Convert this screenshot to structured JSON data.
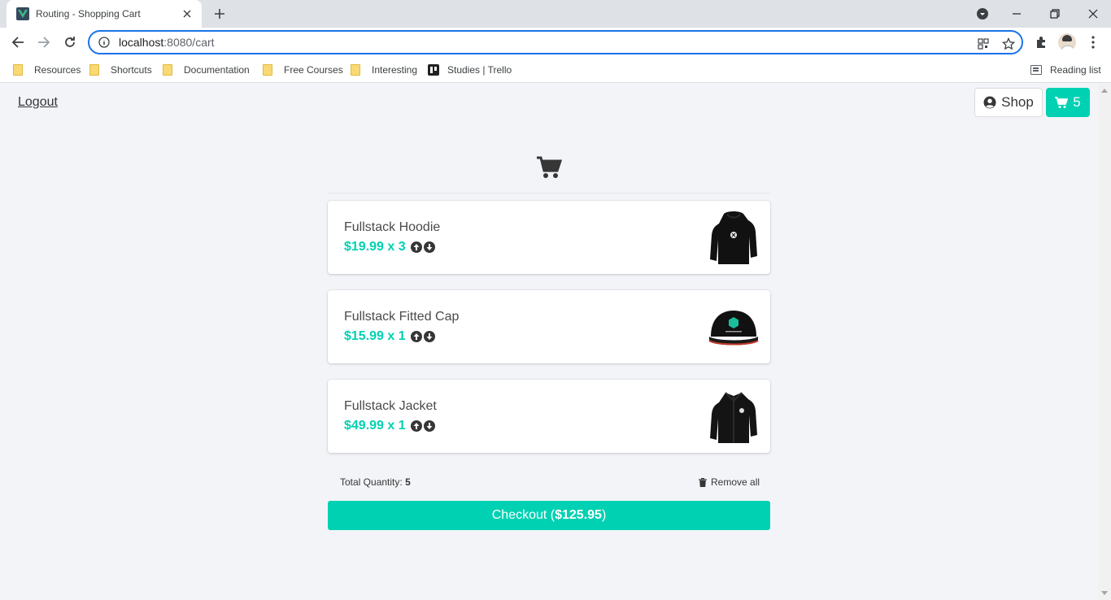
{
  "browser": {
    "tab_title": "Routing - Shopping Cart",
    "url_host": "localhost",
    "url_rest": ":8080/cart",
    "bookmarks": [
      "Resources",
      "Shortcuts",
      "Documentation",
      "Free Courses",
      "Interesting",
      "Studies | Trello"
    ],
    "reading_list": "Reading list"
  },
  "header": {
    "logout": "Logout",
    "shop": "Shop",
    "cart_count": "5"
  },
  "cart": {
    "items": [
      {
        "name": "Fullstack Hoodie",
        "price": "$19.99",
        "qty": "3",
        "image": "hoodie-image"
      },
      {
        "name": "Fullstack Fitted Cap",
        "price": "$15.99",
        "qty": "1",
        "image": "cap-image"
      },
      {
        "name": "Fullstack Jacket",
        "price": "$49.99",
        "qty": "1",
        "image": "jacket-image"
      }
    ],
    "total_qty_label": "Total Quantity:",
    "total_qty": "5",
    "remove_all": "Remove all",
    "checkout_label": "Checkout",
    "checkout_total": "$125.95"
  },
  "colors": {
    "accent": "#00d1b2",
    "text": "#4a4a4a",
    "background": "#f2f4f8"
  }
}
